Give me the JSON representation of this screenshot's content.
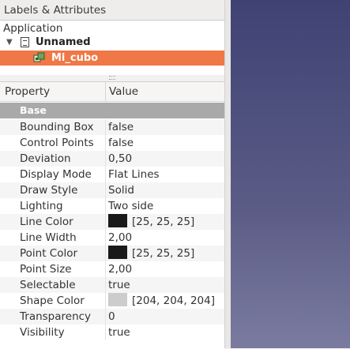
{
  "panel": {
    "title": "Labels & Attributes"
  },
  "tree": {
    "application_label": "Application",
    "document_label": "Unnamed",
    "object_label": "Mi_cubo"
  },
  "properties": {
    "header": {
      "property": "Property",
      "value": "Value"
    },
    "group": "Base",
    "rows": [
      {
        "name": "Bounding Box",
        "value": "false"
      },
      {
        "name": "Control Points",
        "value": "false"
      },
      {
        "name": "Deviation",
        "value": "0,50"
      },
      {
        "name": "Display Mode",
        "value": "Flat Lines"
      },
      {
        "name": "Draw Style",
        "value": "Solid"
      },
      {
        "name": "Lighting",
        "value": "Two side"
      },
      {
        "name": "Line Color",
        "value": "[25, 25, 25]",
        "swatch": "#191919"
      },
      {
        "name": "Line Width",
        "value": "2,00"
      },
      {
        "name": "Point Color",
        "value": "[25, 25, 25]",
        "swatch": "#191919"
      },
      {
        "name": "Point Size",
        "value": "2,00"
      },
      {
        "name": "Selectable",
        "value": "true"
      },
      {
        "name": "Shape Color",
        "value": "[204, 204, 204]",
        "swatch": "#cccccc"
      },
      {
        "name": "Transparency",
        "value": "0"
      },
      {
        "name": "Visibility",
        "value": "true"
      }
    ]
  },
  "colors": {
    "selection": "#f07746",
    "group_bg": "#a9a9a9",
    "viewport_top": "#3f4273",
    "viewport_bottom": "#7a7b9f"
  }
}
